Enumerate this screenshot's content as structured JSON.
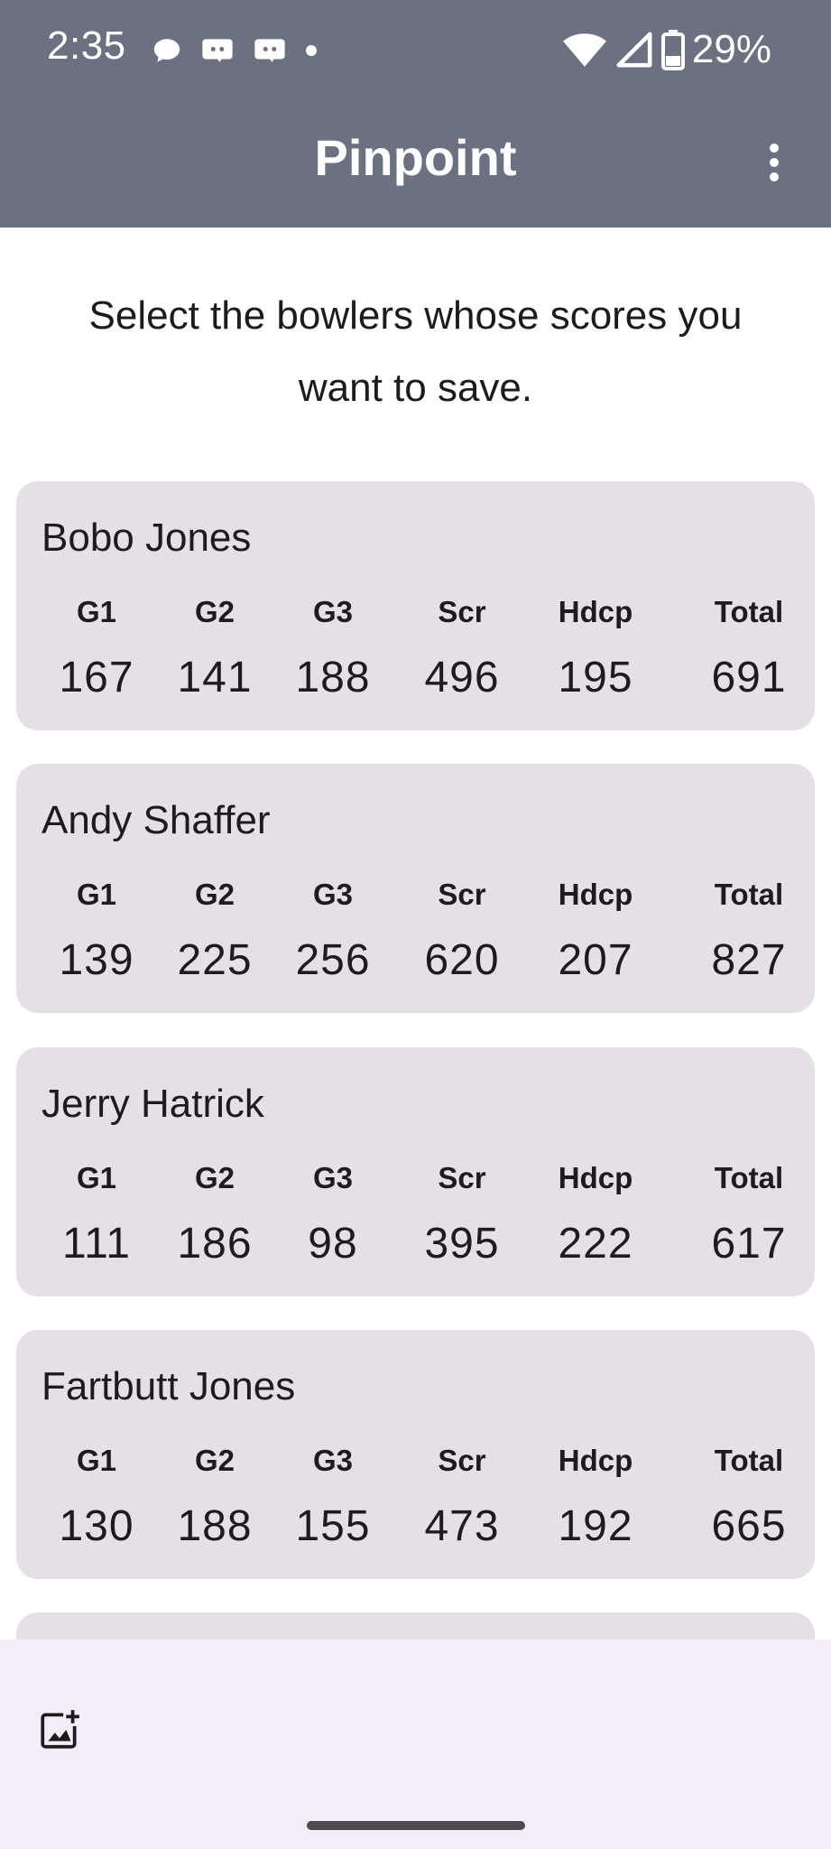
{
  "status_bar": {
    "time": "2:35",
    "battery": "29%"
  },
  "header": {
    "title": "Pinpoint"
  },
  "instruction": "Select the bowlers whose scores you want to save.",
  "columns": [
    "G1",
    "G2",
    "G3",
    "Scr",
    "Hdcp",
    "Total"
  ],
  "bowlers": [
    {
      "name": "Bobo Jones",
      "scores": [
        "167",
        "141",
        "188",
        "496",
        "195",
        "691"
      ]
    },
    {
      "name": "Andy Shaffer",
      "scores": [
        "139",
        "225",
        "256",
        "620",
        "207",
        "827"
      ]
    },
    {
      "name": "Jerry Hatrick",
      "scores": [
        "111",
        "186",
        "98",
        "395",
        "222",
        "617"
      ]
    },
    {
      "name": "Fartbutt Jones",
      "scores": [
        "130",
        "188",
        "155",
        "473",
        "192",
        "665"
      ]
    }
  ],
  "colors": {
    "header": "#6b7180",
    "card": "#e5e0e6",
    "bottom_bar": "#f3edf7"
  }
}
